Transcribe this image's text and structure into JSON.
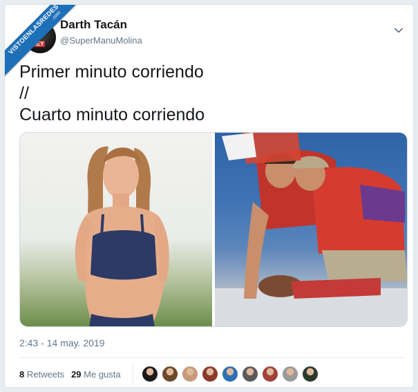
{
  "watermark": {
    "main": "VISTOENLASREDES",
    "sub": ".com"
  },
  "user": {
    "display_name": "Darth Tacán",
    "handle": "@SuperManuMolina",
    "avatar_badge": "HEY"
  },
  "tweet": {
    "lines": [
      "Primer minuto corriendo",
      "//",
      "Cuarto minuto corriendo"
    ]
  },
  "timestamp": "2:43 - 14 may. 2019",
  "stats": {
    "retweets_count": "8",
    "retweets_label": "Retweets",
    "likes_count": "29",
    "likes_label": "Me gusta"
  },
  "colors": {
    "accent": "#1d6fb8",
    "text_primary": "#14171a",
    "text_secondary": "#657786"
  },
  "likers": [
    {
      "color": "#1b1b1b"
    },
    {
      "color": "#6b4a2a"
    },
    {
      "color": "#c79a7a"
    },
    {
      "color": "#8a3b2b"
    },
    {
      "color": "#2d6fb3"
    },
    {
      "color": "#5a5a5a"
    },
    {
      "color": "#a1423a"
    },
    {
      "color": "#9a9a9a"
    },
    {
      "color": "#2b3b2b"
    }
  ]
}
